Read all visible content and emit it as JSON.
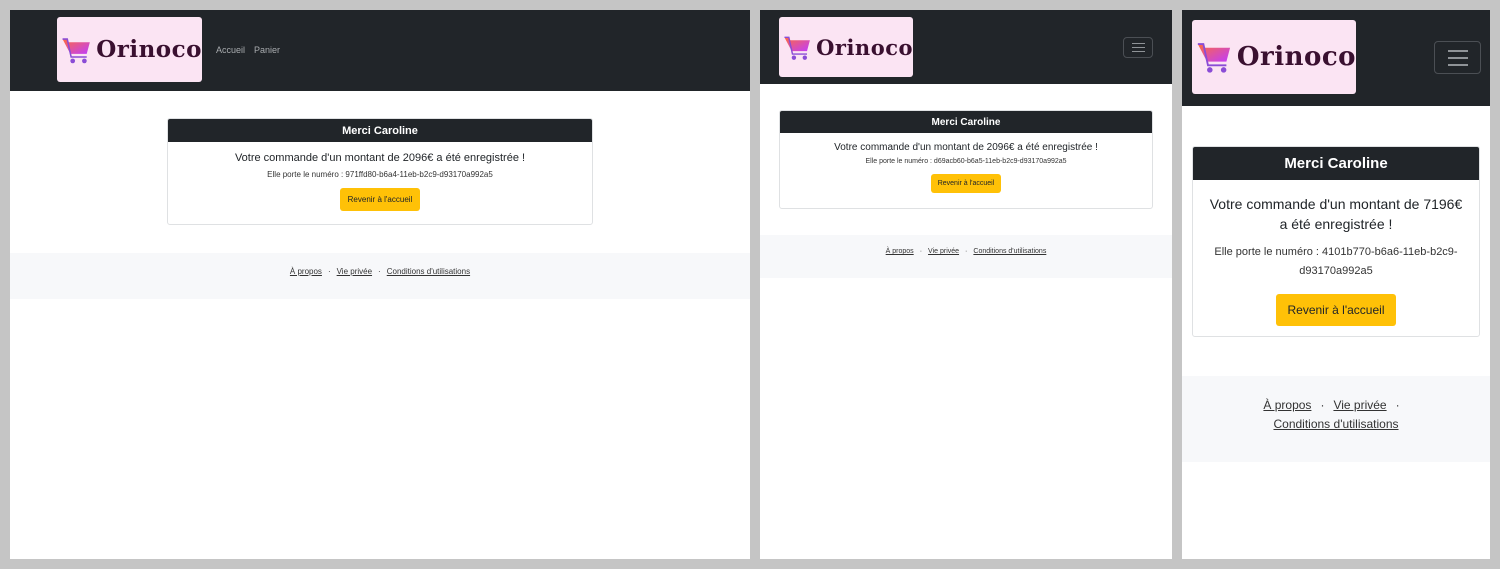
{
  "brand": {
    "name": "Orinoco"
  },
  "nav": {
    "items": [
      {
        "label": "Accueil"
      },
      {
        "label": "Panier"
      }
    ]
  },
  "views": [
    {
      "card_header": "Merci Caroline",
      "message": "Votre commande d'un montant de 2096€ a été enregistrée !",
      "order_number": "Elle porte le numéro : 971ffd80-b6a4-11eb-b2c9-d93170a992a5",
      "button_label": "Revenir à l'accueil"
    },
    {
      "card_header": "Merci Caroline",
      "message": "Votre commande d'un montant de 2096€ a été enregistrée !",
      "order_number": "Elle porte le numéro : d69acb60-b6a5-11eb-b2c9-d93170a992a5",
      "button_label": "Revenir à l'accueil"
    },
    {
      "card_header": "Merci Caroline",
      "message": "Votre commande d'un montant de 7196€ a été enregistrée !",
      "order_number": "Elle porte le numéro : 4101b770-b6a6-11eb-b2c9-d93170a992a5",
      "button_label": "Revenir à l'accueil"
    }
  ],
  "footer": {
    "links": [
      {
        "label": "À propos"
      },
      {
        "label": "Vie privée"
      },
      {
        "label": "Conditions d'utilisations"
      }
    ],
    "separator": "·"
  },
  "colors": {
    "navbar": "#212529",
    "logo_background": "#fbe4f3",
    "button": "#ffc107",
    "footer_background": "#f7f8fa",
    "page_background": "#c5c5c5"
  },
  "icons": {
    "logo": "shopping-cart-icon",
    "menu": "hamburger-menu-icon"
  }
}
